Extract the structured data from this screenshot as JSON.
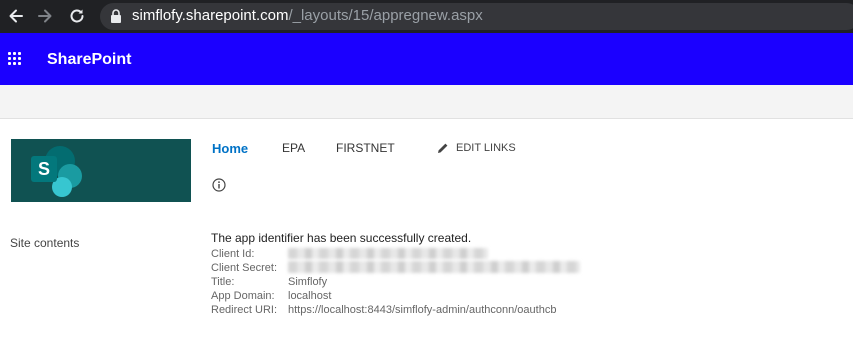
{
  "browser": {
    "url_host": "simflofy.sharepoint.com",
    "url_path": "/_layouts/15/appregnew.aspx"
  },
  "suite": {
    "title": "SharePoint"
  },
  "top_nav": {
    "items": [
      "Home",
      "EPA",
      "FIRSTNET"
    ],
    "edit_links": "EDIT LINKS"
  },
  "left_nav": {
    "items": [
      "Site contents"
    ]
  },
  "result": {
    "message": "The app identifier has been successfully created.",
    "fields": [
      {
        "label": "Client Id:",
        "value": ""
      },
      {
        "label": "Client Secret:",
        "value": ""
      },
      {
        "label": "Title:",
        "value": "Simflofy"
      },
      {
        "label": "App Domain:",
        "value": "localhost"
      },
      {
        "label": "Redirect URI:",
        "value": "https://localhost:8443/simflofy-admin/authconn/oauthcb"
      }
    ]
  },
  "colors": {
    "suite_bar": "#1b00ff",
    "logo_background": "#105252",
    "nav_selected": "#0072c6",
    "browser_chrome": "#202124"
  },
  "icons": [
    "back-arrow-icon",
    "forward-arrow-icon",
    "reload-icon",
    "lock-icon",
    "waffle-icon",
    "sharepoint-logo-icon",
    "pencil-icon",
    "info-icon"
  ]
}
